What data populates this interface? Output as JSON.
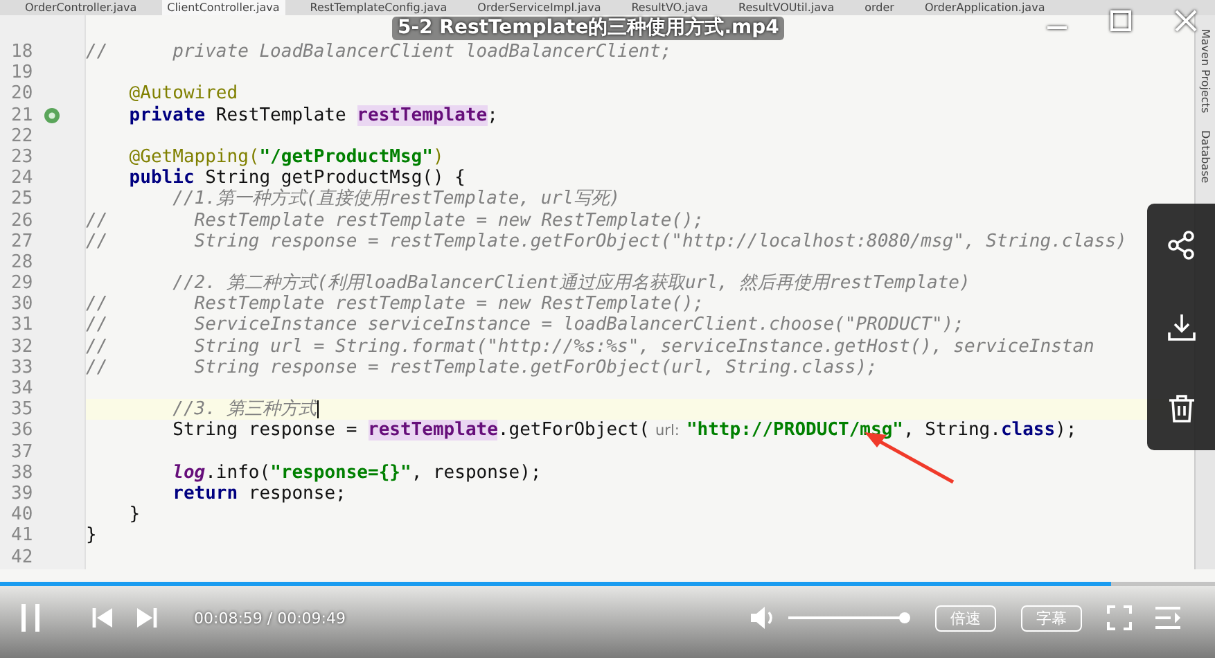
{
  "player": {
    "title": "5-2 RestTemplate的三种使用方式.mp4",
    "time": "00:08:59 / 00:09:49",
    "progress": {
      "level": 0.915
    },
    "volume": {
      "level": 1.0
    },
    "buttons": [
      "倍速",
      "字幕"
    ]
  },
  "editor": {
    "tabs": [
      {
        "label": "OrderController.java",
        "selected": false
      },
      {
        "label": "ClientController.java",
        "selected": true
      },
      {
        "label": "RestTemplateConfig.java",
        "selected": false
      },
      {
        "label": "OrderServiceImpl.java",
        "selected": false
      },
      {
        "label": "ResultVO.java",
        "selected": false
      },
      {
        "label": "ResultVOUtil.java",
        "selected": false
      },
      {
        "label": "order",
        "selected": false
      },
      {
        "label": "OrderApplication.java",
        "selected": false
      }
    ],
    "side_tools": [
      "Maven Projects",
      "Database"
    ],
    "lines": [
      {
        "number": "18",
        "current": false,
        "segments": [
          {
            "kind": "comment",
            "text": "//      private LoadBalancerClient loadBalancerClient;"
          }
        ]
      },
      {
        "number": "19",
        "current": false
      },
      {
        "number": "20",
        "current": false,
        "segments": [
          {
            "kind": "annotation",
            "text": "    @Autowired"
          }
        ]
      },
      {
        "number": "21",
        "current": false,
        "kind": "bean",
        "segments": [
          {
            "kind": "keyword",
            "text": "    private"
          },
          {
            "kind": "plain",
            "text": " RestTemplate "
          },
          {
            "kind": "field",
            "text": "restTemplate"
          },
          {
            "kind": "plain",
            "text": ";"
          }
        ]
      },
      {
        "number": "22",
        "current": false
      },
      {
        "number": "23",
        "current": false,
        "segments": [
          {
            "kind": "annotation",
            "text": "    @GetMapping("
          },
          {
            "kind": "string",
            "text": "\"/getProductMsg\""
          },
          {
            "kind": "annotation",
            "text": ")"
          }
        ]
      },
      {
        "number": "24",
        "current": false,
        "segments": [
          {
            "kind": "keyword",
            "text": "    public"
          },
          {
            "kind": "plain",
            "text": " String getProductMsg() {"
          }
        ]
      },
      {
        "number": "25",
        "current": false,
        "segments": [
          {
            "kind": "comment",
            "text": "        //1.第一种方式(直接使用restTemplate, url写死)"
          }
        ]
      },
      {
        "number": "26",
        "current": false,
        "segments": [
          {
            "kind": "comment",
            "text": "//        RestTemplate restTemplate = new RestTemplate();"
          }
        ]
      },
      {
        "number": "27",
        "current": false,
        "segments": [
          {
            "kind": "comment",
            "text": "//        String response = restTemplate.getForObject(\"http://localhost:8080/msg\", String.class)"
          }
        ]
      },
      {
        "number": "28",
        "current": false
      },
      {
        "number": "29",
        "current": false,
        "segments": [
          {
            "kind": "comment",
            "text": "        //2. 第二种方式(利用loadBalancerClient通过应用名获取url, 然后再使用restTemplate)"
          }
        ]
      },
      {
        "number": "30",
        "current": false,
        "segments": [
          {
            "kind": "comment",
            "text": "//        RestTemplate restTemplate = new RestTemplate();"
          }
        ]
      },
      {
        "number": "31",
        "current": false,
        "segments": [
          {
            "kind": "comment",
            "text": "//        ServiceInstance serviceInstance = loadBalancerClient.choose(\"PRODUCT\");"
          }
        ]
      },
      {
        "number": "32",
        "current": false,
        "segments": [
          {
            "kind": "comment",
            "text": "//        String url = String.format(\"http://%s:%s\", serviceInstance.getHost(), serviceInstan"
          }
        ]
      },
      {
        "number": "33",
        "current": false,
        "segments": [
          {
            "kind": "comment",
            "text": "//        String response = restTemplate.getForObject(url, String.class);"
          }
        ]
      },
      {
        "number": "34",
        "current": false
      },
      {
        "number": "35",
        "current": true,
        "segments": [
          {
            "kind": "comment",
            "text": "        //3. 第三种方式"
          }
        ]
      },
      {
        "number": "36",
        "current": false,
        "segments": [
          {
            "kind": "plain",
            "text": "        String response = "
          },
          {
            "kind": "field",
            "text": "restTemplate"
          },
          {
            "kind": "plain",
            "text": ".getForObject("
          },
          {
            "kind": "hint",
            "text": "url:"
          },
          {
            "kind": "string",
            "text": "\"http://PRODUCT/msg\""
          },
          {
            "kind": "plain",
            "text": ", String."
          },
          {
            "kind": "keyword",
            "text": "class"
          },
          {
            "kind": "plain",
            "text": ");"
          }
        ]
      },
      {
        "number": "37",
        "current": false
      },
      {
        "number": "38",
        "current": false,
        "segments": [
          {
            "kind": "static",
            "text": "        log"
          },
          {
            "kind": "plain",
            "text": ".info("
          },
          {
            "kind": "string",
            "text": "\"response={}\""
          },
          {
            "kind": "plain",
            "text": ", response);"
          }
        ]
      },
      {
        "number": "39",
        "current": false,
        "segments": [
          {
            "kind": "keyword",
            "text": "        return"
          },
          {
            "kind": "plain",
            "text": " response;"
          }
        ]
      },
      {
        "number": "40",
        "current": false,
        "segments": [
          {
            "kind": "plain",
            "text": "    }"
          }
        ]
      },
      {
        "number": "41",
        "current": false,
        "segments": [
          {
            "kind": "plain",
            "text": "}"
          }
        ]
      },
      {
        "number": "42",
        "current": false
      }
    ]
  }
}
